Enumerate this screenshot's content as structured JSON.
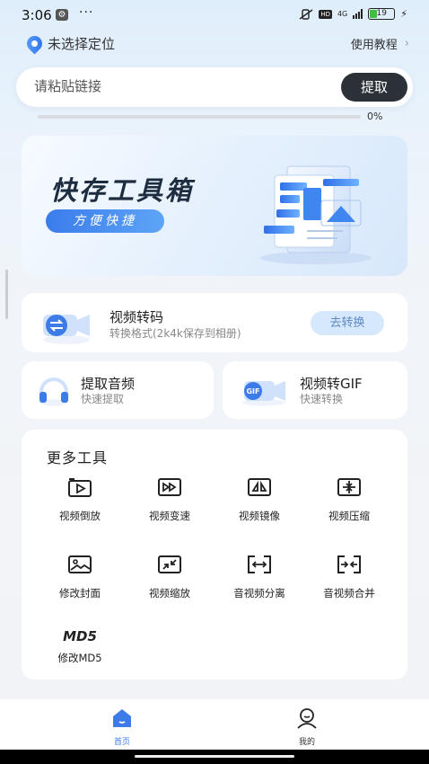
{
  "status_bar": {
    "time": "3:06",
    "dots": "···",
    "hd": "HD",
    "network": "4G",
    "battery": "19"
  },
  "header": {
    "location": "未选择定位",
    "tutorial": "使用教程"
  },
  "paste": {
    "placeholder": "请粘贴链接",
    "button": "提取"
  },
  "progress": {
    "value": 0,
    "label": "0%"
  },
  "banner": {
    "title": "快存工具箱",
    "subtitle": "方便快捷"
  },
  "convert_card": {
    "title": "视频转码",
    "subtitle": "转换格式(2k4k保存到相册)",
    "button": "去转换"
  },
  "audio_card": {
    "title": "提取音频",
    "subtitle": "快速提取"
  },
  "gif_card": {
    "title": "视频转GIF",
    "subtitle": "快速转换",
    "icon_text": "GIF"
  },
  "tools": {
    "heading": "更多工具",
    "items": [
      {
        "label": "视频倒放",
        "icon": "video-reverse-icon"
      },
      {
        "label": "视频变速",
        "icon": "video-speed-icon"
      },
      {
        "label": "视频镜像",
        "icon": "video-mirror-icon"
      },
      {
        "label": "视频压缩",
        "icon": "video-compress-icon"
      },
      {
        "label": "修改封面",
        "icon": "cover-image-icon"
      },
      {
        "label": "视频缩放",
        "icon": "video-scale-icon"
      },
      {
        "label": "音视频分离",
        "icon": "av-split-icon"
      },
      {
        "label": "音视频合并",
        "icon": "av-merge-icon"
      },
      {
        "label": "修改MD5",
        "icon": "md5-icon",
        "glyph": "MD5"
      }
    ]
  },
  "bottom_nav": {
    "items": [
      {
        "label": "首页",
        "icon": "home-icon",
        "active": true
      },
      {
        "label": "我的",
        "icon": "profile-icon",
        "active": false
      }
    ]
  },
  "colors": {
    "accent": "#3d7be8",
    "dark_button": "#2b3137",
    "nav_active": "#3d7be8"
  }
}
